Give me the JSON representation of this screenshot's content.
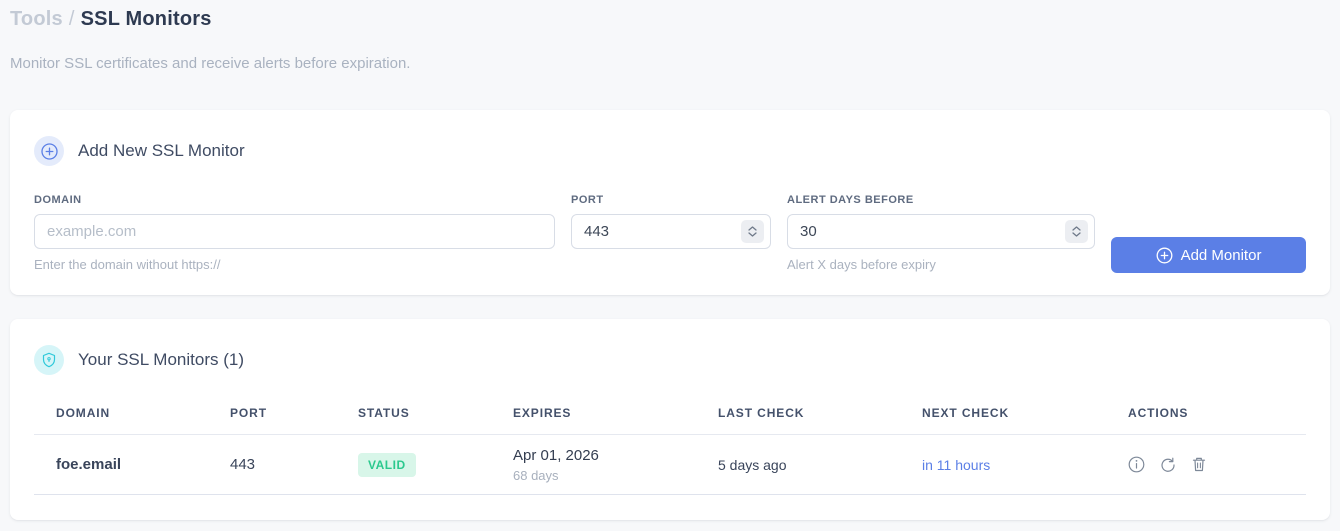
{
  "page": {
    "breadcrumb": {
      "section": "Tools",
      "separator": "/",
      "current": "SSL Monitors"
    },
    "subtitle": "Monitor SSL certificates and receive alerts before expiration."
  },
  "add_monitor": {
    "title": "Add New SSL Monitor",
    "fields": {
      "domain": {
        "label": "DOMAIN",
        "placeholder": "example.com",
        "helper": "Enter the domain without https://"
      },
      "port": {
        "label": "PORT",
        "value": "443"
      },
      "alert_days": {
        "label": "ALERT DAYS BEFORE",
        "value": "30",
        "helper": "Alert X days before expiry"
      }
    },
    "submit_label": "Add Monitor"
  },
  "monitors": {
    "title": "Your SSL Monitors (1)",
    "table": {
      "headers": [
        "DOMAIN",
        "PORT",
        "STATUS",
        "EXPIRES",
        "LAST CHECK",
        "NEXT CHECK",
        "ACTIONS"
      ],
      "rows": [
        {
          "domain": "foe.email",
          "port": "443",
          "status": "VALID",
          "expires_date": "Apr 01, 2026",
          "expires_in": "68 days",
          "last_check": "5 days ago",
          "next_check": "in 11 hours"
        }
      ]
    }
  },
  "colors": {
    "accent_blue": "#5b7fe6",
    "valid_green": "#2bc98e",
    "valid_bg": "#d8f6e9",
    "shield_cyan": "#2fc9da"
  }
}
